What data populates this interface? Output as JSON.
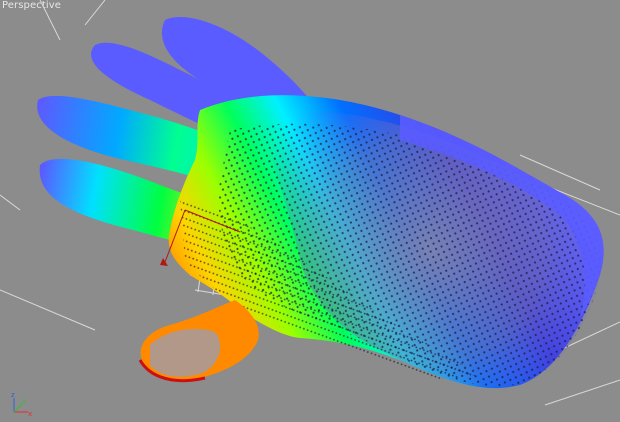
{
  "viewport": {
    "label": "Perspective",
    "background_color": "#8c8c8c",
    "grid_color": "#d8d8d8"
  },
  "model": {
    "name": "hand mesh",
    "shell_color": "#5a5cff",
    "heatmap_colors": [
      "#ff1a00",
      "#ff7a00",
      "#ffd400",
      "#9cff00",
      "#00ff5a",
      "#00f0ff",
      "#0070ff",
      "#2020e0"
    ],
    "dot_color": "#1a1a40"
  },
  "gizmo": {
    "axes": [
      {
        "name": "x",
        "color": "#e03030"
      },
      {
        "name": "y",
        "color": "#30c030"
      },
      {
        "name": "z",
        "color": "#3060e0"
      }
    ]
  }
}
